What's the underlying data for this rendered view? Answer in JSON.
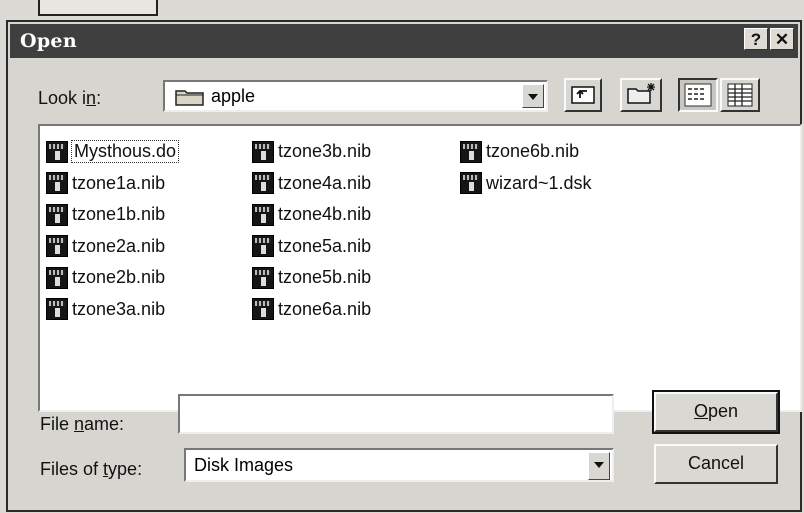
{
  "window": {
    "title": "Open",
    "help_label": "?",
    "close_label": "✕"
  },
  "lookin": {
    "label": "Look in:",
    "value": "apple"
  },
  "toolbar": {
    "up_folder_icon": "up-folder-icon",
    "new_folder_icon": "new-folder-icon",
    "list_view_icon": "list-view-icon",
    "details_view_icon": "details-view-icon"
  },
  "files": {
    "col1": [
      "Mysthous.do",
      "tzone1a.nib",
      "tzone1b.nib",
      "tzone2a.nib",
      "tzone2b.nib",
      "tzone3a.nib"
    ],
    "col2": [
      "tzone3b.nib",
      "tzone4a.nib",
      "tzone4b.nib",
      "tzone5a.nib",
      "tzone5b.nib",
      "tzone6a.nib"
    ],
    "col3": [
      "tzone6b.nib",
      "wizard~1.dsk"
    ]
  },
  "filename": {
    "label": "File name:",
    "value": ""
  },
  "filetype": {
    "label": "Files of type:",
    "value": "Disk Images"
  },
  "buttons": {
    "open": "Open",
    "cancel": "Cancel"
  }
}
